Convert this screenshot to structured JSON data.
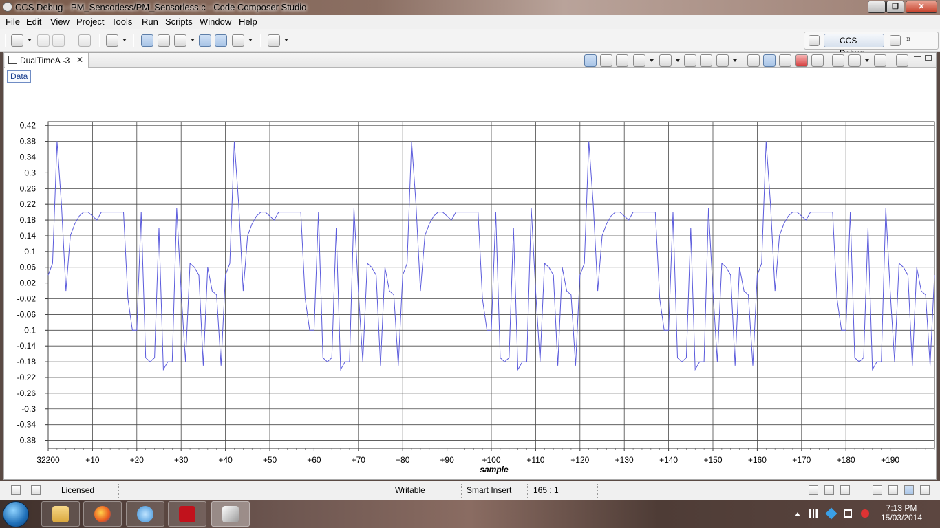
{
  "window": {
    "title": "CCS Debug - PM_Sensorless/PM_Sensorless.c - Code Composer Studio"
  },
  "menu": [
    "File",
    "Edit",
    "View",
    "Project",
    "Tools",
    "Run",
    "Scripts",
    "Window",
    "Help"
  ],
  "perspective": {
    "label": "CCS Debug",
    "overflow": "»"
  },
  "view": {
    "tab_label": "DualTimeA -3",
    "close_glyph": "✕",
    "data_tab": "Data"
  },
  "chart_data": {
    "type": "line",
    "xlabel": "sample",
    "x_ticks": [
      "32200",
      "+10",
      "+20",
      "+30",
      "+40",
      "+50",
      "+60",
      "+70",
      "+80",
      "+90",
      "+100",
      "+110",
      "+120",
      "+130",
      "+140",
      "+150",
      "+160",
      "+170",
      "+180",
      "+190"
    ],
    "y_ticks": [
      "0.42",
      "0.38",
      "0.34",
      "0.3",
      "0.26",
      "0.22",
      "0.18",
      "0.14",
      "0.1",
      "0.06",
      "0.02",
      "-0.02",
      "-0.06",
      "-0.1",
      "-0.14",
      "-0.18",
      "-0.22",
      "-0.26",
      "-0.3",
      "-0.34",
      "-0.38"
    ],
    "ylim": [
      -0.4,
      0.43
    ],
    "xlim": [
      0,
      200
    ],
    "grid": true,
    "line_color": "#5b5bdc",
    "series": [
      {
        "x": [
          0,
          1,
          2,
          3,
          4,
          5,
          6,
          7,
          8,
          9,
          10,
          11,
          12,
          13,
          14,
          15,
          16,
          17,
          18,
          19,
          20,
          21,
          22,
          23,
          24,
          25,
          26,
          27,
          28,
          29,
          30,
          31,
          32,
          33,
          34,
          35,
          36,
          37,
          38,
          39
        ],
        "values": [
          0.04,
          0.07,
          0.38,
          0.22,
          0.0,
          0.14,
          0.17,
          0.19,
          0.2,
          0.2,
          0.19,
          0.18,
          0.2,
          0.2,
          0.2,
          0.2,
          0.2,
          0.2,
          -0.02,
          -0.1,
          -0.1,
          0.2,
          -0.17,
          -0.18,
          -0.17,
          0.16,
          -0.2,
          -0.18,
          -0.18,
          0.21,
          0.0,
          -0.18,
          0.07,
          0.06,
          0.04,
          -0.19,
          0.06,
          0.0,
          -0.01,
          -0.19
        ]
      }
    ]
  },
  "status": {
    "licensed": "Licensed",
    "writable": "Writable",
    "insert_mode": "Smart Insert",
    "position": "165 : 1"
  },
  "taskbar": {
    "time": "7:13 PM",
    "date": "15/03/2014"
  },
  "icons": [
    "app-icon",
    "new-icon",
    "save-icon",
    "debug-icon",
    "terminate-icon",
    "search-icon",
    "zoom-in-icon",
    "zoom-out-icon",
    "binoculars-icon",
    "close-red-icon"
  ]
}
